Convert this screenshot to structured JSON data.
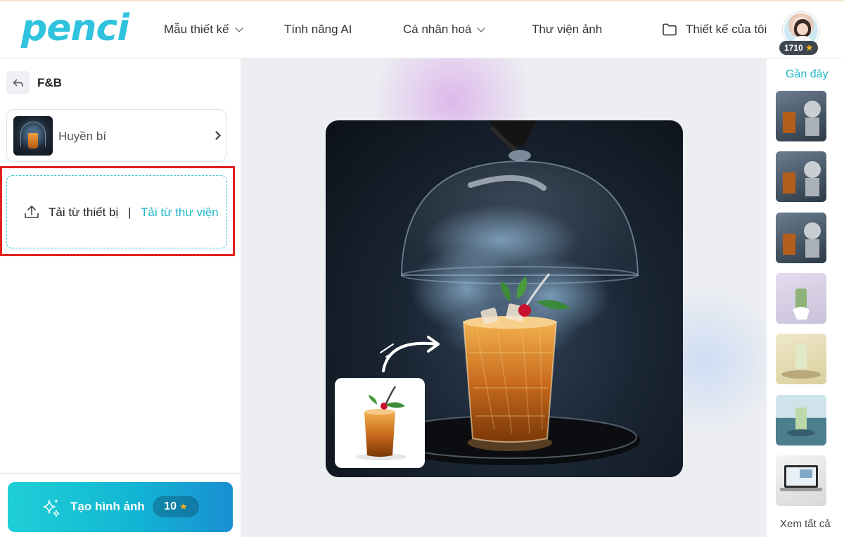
{
  "header": {
    "logo": "penci",
    "nav": [
      {
        "label": "Mẫu thiết kế",
        "dropdown": true
      },
      {
        "label": "Tính năng AI",
        "dropdown": false
      },
      {
        "label": "Cá nhân hoá",
        "dropdown": true
      },
      {
        "label": "Thư viện ảnh",
        "dropdown": false
      }
    ],
    "my_designs": "Thiết kế của tôi",
    "credits": "1710"
  },
  "left_panel": {
    "title": "F&B",
    "style_option": "Huyền bí",
    "upload_device": "Tải từ thiết bị",
    "upload_separator": "|",
    "upload_library": "Tải từ thư viện",
    "create_button": "Tạo hình ảnh",
    "create_cost": "10"
  },
  "right_panel": {
    "recent_title": "Gần đây",
    "see_all": "Xem tất cả"
  },
  "colors": {
    "accent": "#20b7c8",
    "highlight": "#e02020",
    "badge": "#3e4650",
    "star": "#f6b21a"
  },
  "icons": [
    "back-arrow-icon",
    "chevron-right-icon",
    "upload-icon",
    "sparkle-icon",
    "star-icon",
    "folder-icon",
    "chevron-down-icon"
  ]
}
